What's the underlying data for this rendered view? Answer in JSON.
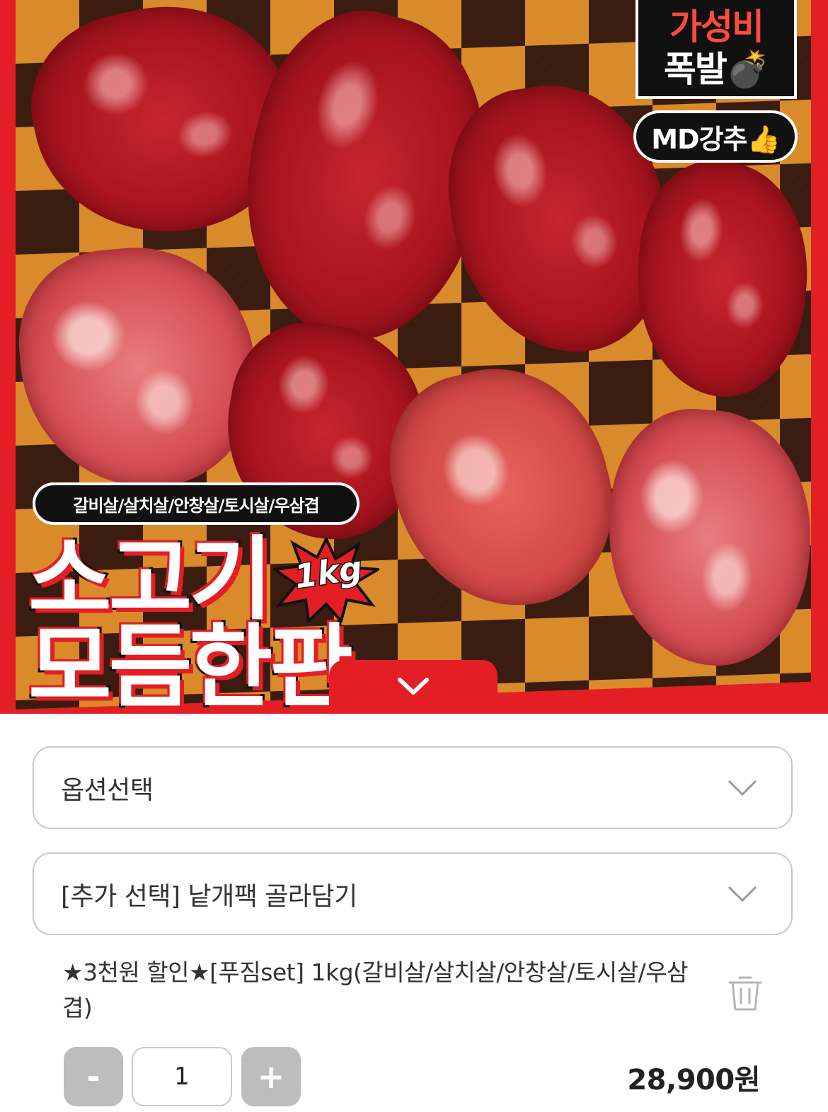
{
  "hero": {
    "badge_line1": "가성비",
    "badge_line2": "폭발💣",
    "md_badge": "MD강추👍",
    "cuts_label": "갈비살/살치살/안창살/토시살/우삼겹",
    "title_line1": "소고기",
    "title_line2": "모듬한판",
    "weight_burst": "1kg",
    "expand_icon": "chevron-down-icon"
  },
  "options": {
    "select_option": "옵션선택",
    "select_addon": "[추가 선택] 낱개팩 골라담기"
  },
  "cart_item": {
    "name": "★3천원 할인★[푸짐set] 1kg(갈비살/살치살/안창살/토시살/우삼겹)",
    "quantity": "1",
    "minus_label": "-",
    "plus_label": "+",
    "price": "28,900원"
  },
  "colors": {
    "accent": "#e31e24",
    "button_gray": "#bdbdbd",
    "border": "#c9c9c9"
  }
}
